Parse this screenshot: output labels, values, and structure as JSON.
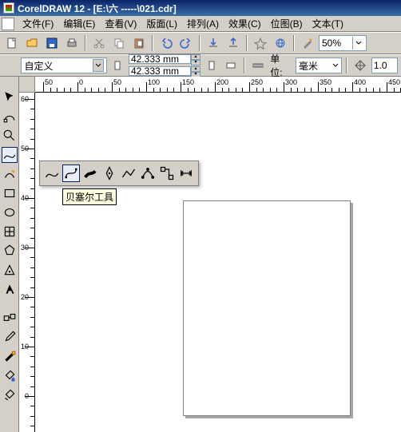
{
  "title": "CorelDRAW 12 - [E:\\六  -----\\021.cdr]",
  "menu": [
    "文件(F)",
    "编辑(E)",
    "查看(V)",
    "版面(L)",
    "排列(A)",
    "效果(C)",
    "位图(B)",
    "文本(T)"
  ],
  "toolbar": {
    "zoom": "50%"
  },
  "prop": {
    "paper": "自定义",
    "width": "42.333 mm",
    "height": "42.333 mm",
    "units_label": "单位:",
    "units": "毫米",
    "nudge": "1.0"
  },
  "flyout": {
    "tooltip": "贝塞尔工具"
  },
  "ruler": {
    "h": [
      "50",
      "0",
      "50",
      "100",
      "150",
      "200",
      "250",
      "300",
      "350",
      "400",
      "450"
    ],
    "v": [
      "60",
      "50",
      "40",
      "30",
      "20",
      "10",
      "0"
    ]
  }
}
